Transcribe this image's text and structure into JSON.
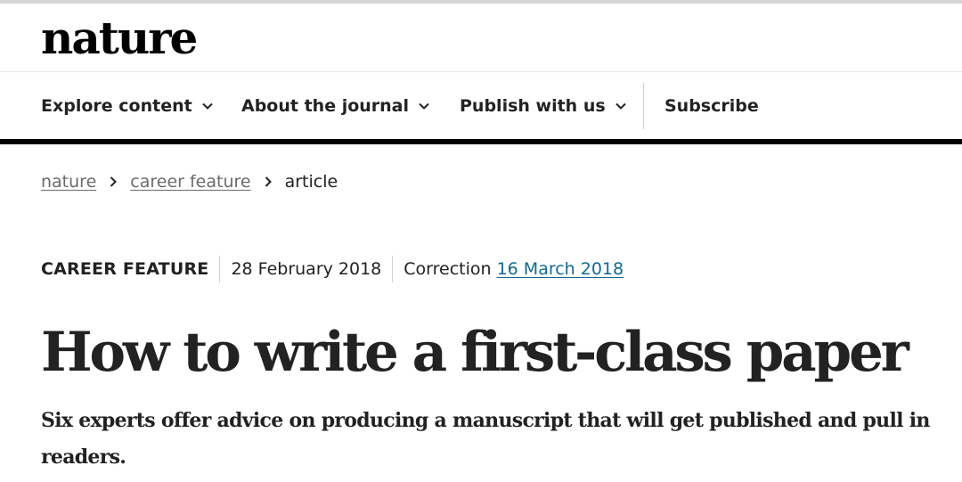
{
  "header": {
    "logo_text": "nature"
  },
  "nav": {
    "items": [
      {
        "label": "Explore content",
        "has_dropdown": true
      },
      {
        "label": "About the journal",
        "has_dropdown": true
      },
      {
        "label": "Publish with us",
        "has_dropdown": true
      },
      {
        "label": "Subscribe",
        "has_dropdown": false
      }
    ]
  },
  "breadcrumb": {
    "items": [
      {
        "label": "nature",
        "link": true
      },
      {
        "label": "career feature",
        "link": true
      },
      {
        "label": "article",
        "link": false
      }
    ],
    "separator_icon": "chevron-right-icon"
  },
  "article": {
    "type": "CAREER FEATURE",
    "published_date": "28 February 2018",
    "correction_label": "Correction",
    "correction_date": "16 March 2018",
    "title": "How to write a first-class paper",
    "standfirst": "Six experts offer advice on producing a manuscript that will get published and pull in readers."
  },
  "colors": {
    "text": "#222222",
    "link_muted": "#6b6b6b",
    "link_accent": "#0f6a95",
    "nav_rule": "#000000",
    "divider": "#d0d0d0"
  }
}
